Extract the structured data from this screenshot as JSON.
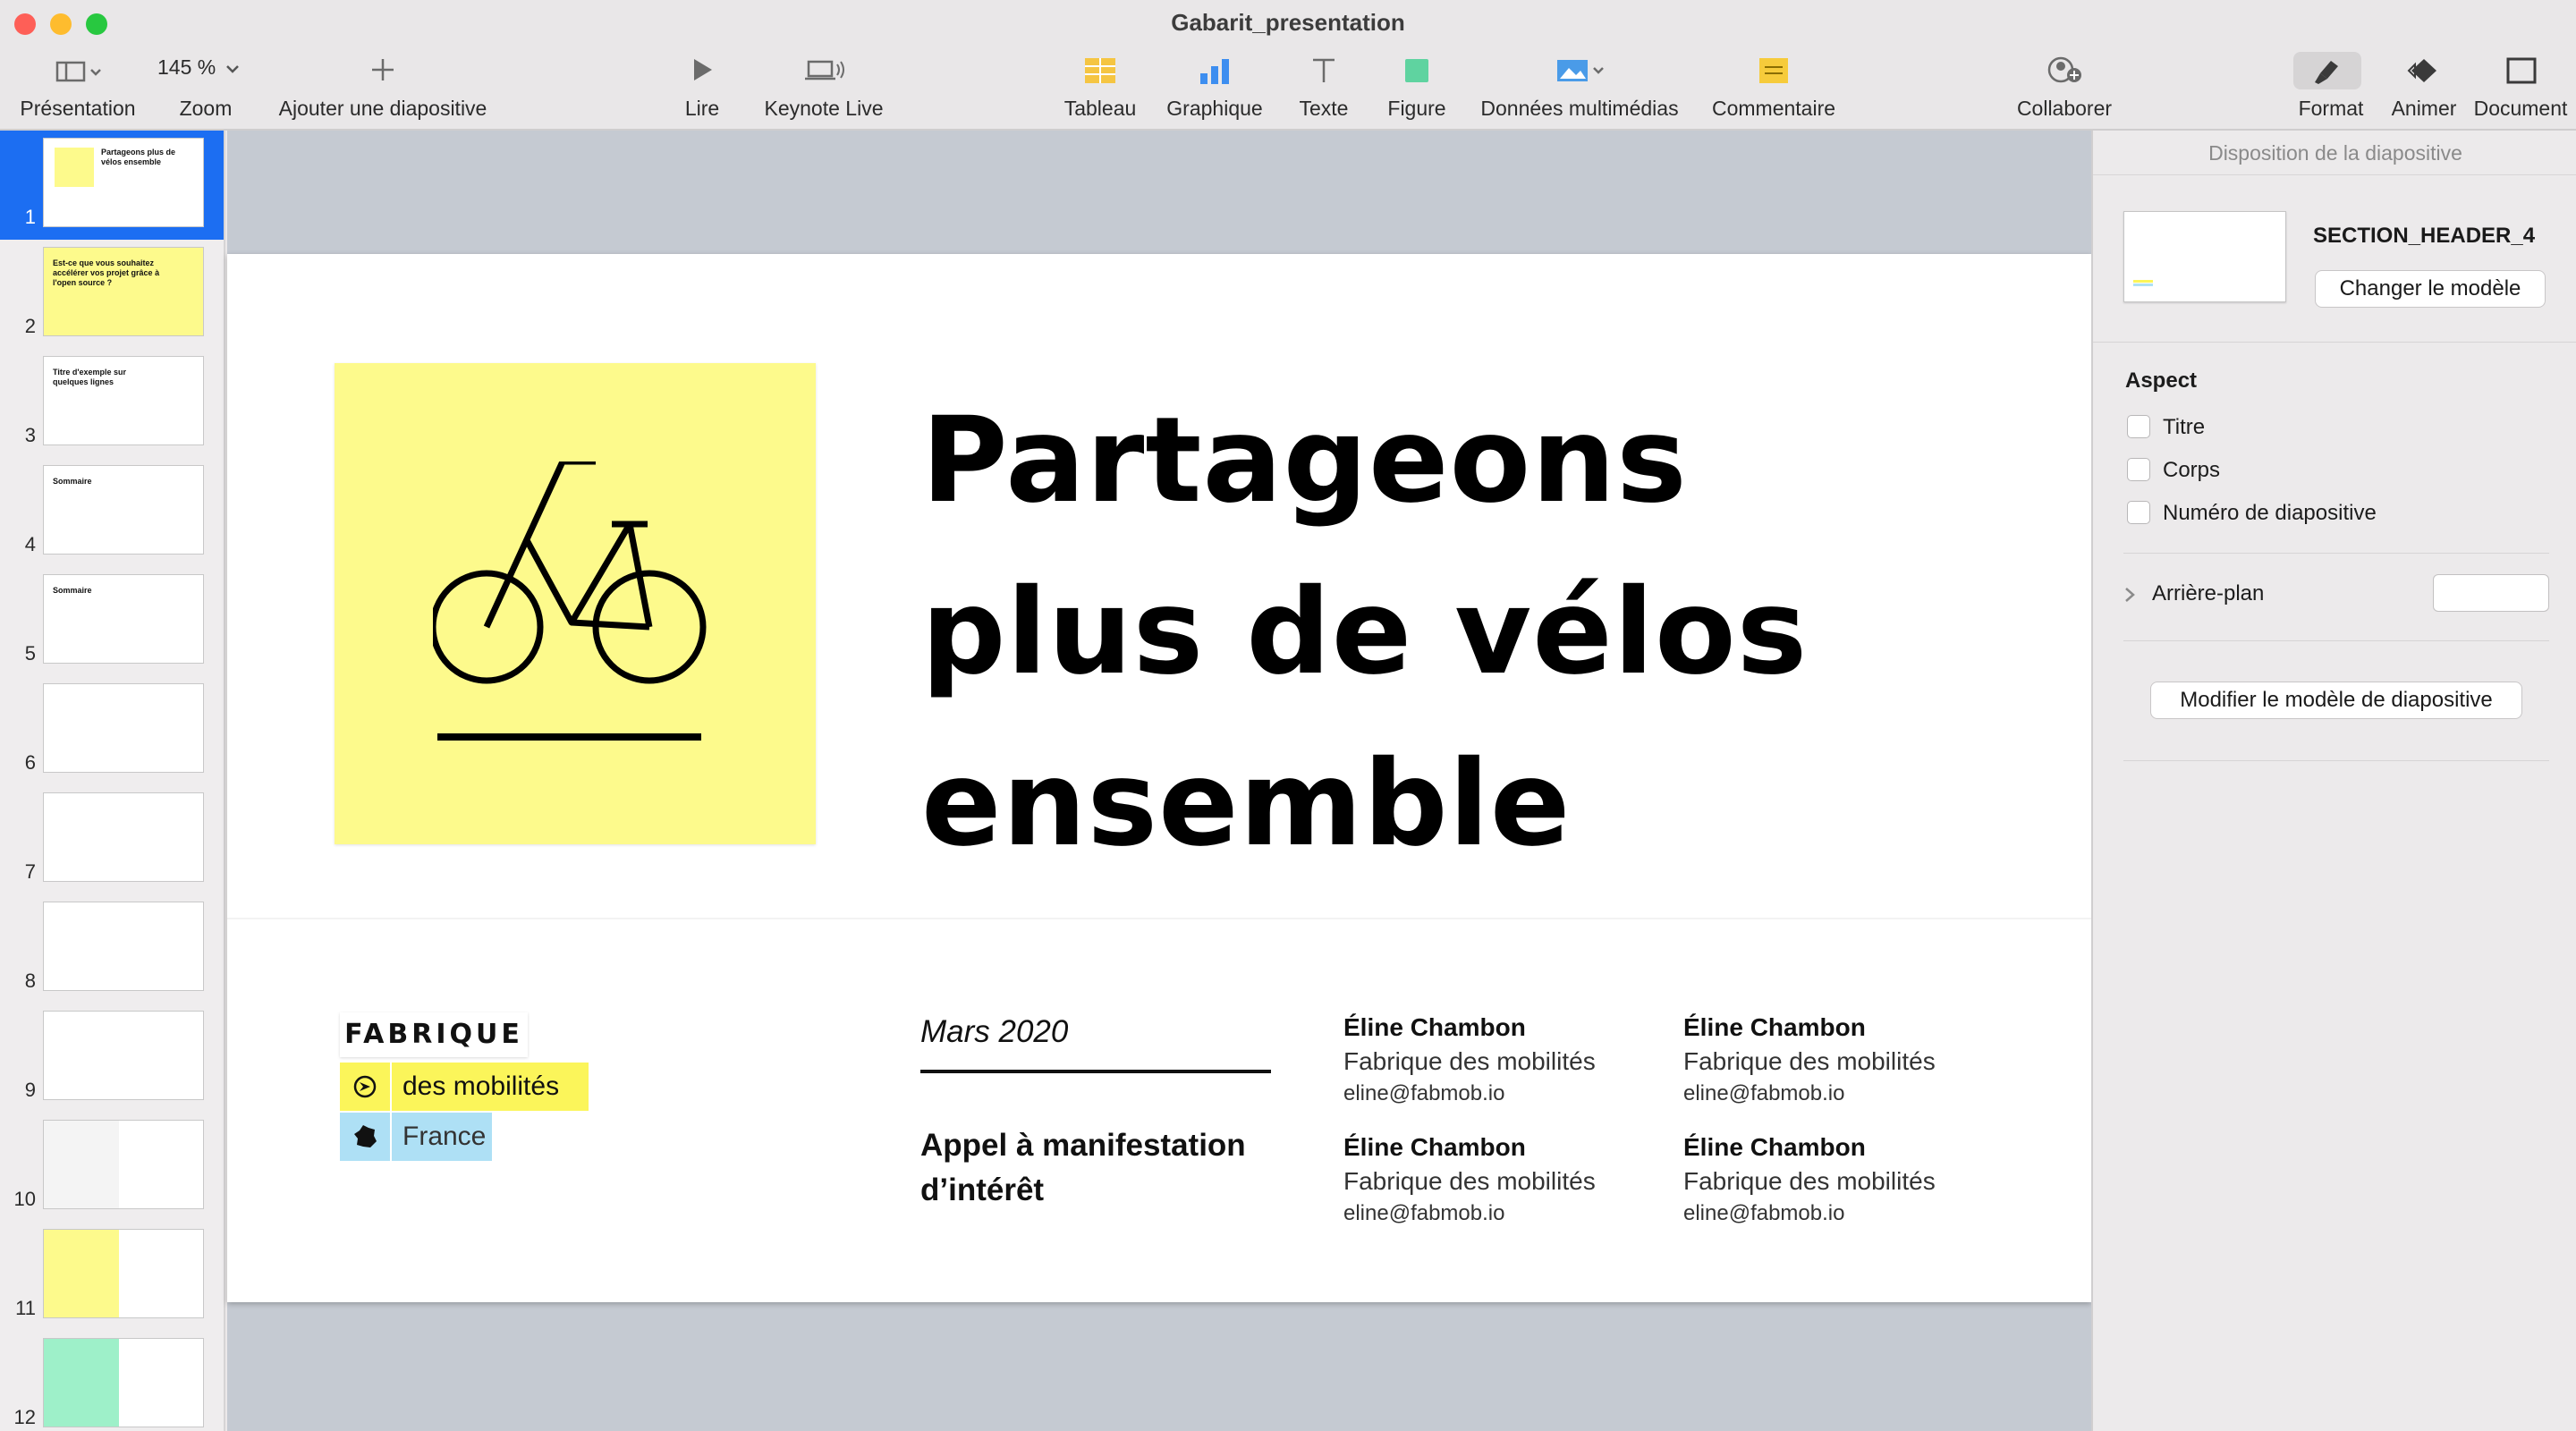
{
  "window": {
    "title": "Gabarit_presentation"
  },
  "toolbar": {
    "presentation_label": "Présentation",
    "zoom_value": "145 %",
    "zoom_label": "Zoom",
    "add_slide_label": "Ajouter une diapositive",
    "play_label": "Lire",
    "keynote_live_label": "Keynote Live",
    "table_label": "Tableau",
    "chart_label": "Graphique",
    "text_label": "Texte",
    "shape_label": "Figure",
    "media_label": "Données multimédias",
    "comment_label": "Commentaire",
    "collaborate_label": "Collaborer",
    "format_label": "Format",
    "animate_label": "Animer",
    "document_label": "Document"
  },
  "navigator": {
    "selected": 1,
    "slides": [
      {
        "num": "1",
        "title": "Partageons plus de vélos ensemble"
      },
      {
        "num": "2",
        "title": "Est-ce que vous souhaitez accélérer vos projet grâce à l'open source ?"
      },
      {
        "num": "3",
        "title": "Titre d'exemple sur quelques lignes"
      },
      {
        "num": "4",
        "title": "Sommaire"
      },
      {
        "num": "5",
        "title": "Sommaire"
      },
      {
        "num": "6",
        "title": ""
      },
      {
        "num": "7",
        "title": ""
      },
      {
        "num": "8",
        "title": ""
      },
      {
        "num": "9",
        "title": ""
      },
      {
        "num": "10",
        "title": ""
      },
      {
        "num": "11",
        "title": ""
      },
      {
        "num": "12",
        "title": ""
      }
    ]
  },
  "slide": {
    "title_line1": "Partageons",
    "title_line2": "plus de vélos",
    "title_line3": "ensemble",
    "date": "Mars 2020",
    "subtitle_line1": "Appel à manifestation",
    "subtitle_line2": "d’intérêt",
    "logo": {
      "word1": "FABRIQUE",
      "word2": "des mobilités",
      "word3": "France"
    },
    "contacts": [
      {
        "name": "Éline Chambon",
        "org": "Fabrique des mobilités",
        "email": "eline@fabmob.io"
      },
      {
        "name": "Éline Chambon",
        "org": "Fabrique des mobilités",
        "email": "eline@fabmob.io"
      },
      {
        "name": "Éline Chambon",
        "org": "Fabrique des mobilités",
        "email": "eline@fabmob.io"
      },
      {
        "name": "Éline Chambon",
        "org": "Fabrique des mobilités",
        "email": "eline@fabmob.io"
      }
    ],
    "colors": {
      "yellow": "#fdfa8c",
      "logo_yellow": "#fbf55a",
      "logo_blue": "#aee0f5",
      "accent": "#1c6ef2"
    }
  },
  "inspector": {
    "header": "Disposition de la diapositive",
    "layout_name": "SECTION_HEADER_4",
    "change_master_label": "Changer le modèle",
    "appearance_label": "Aspect",
    "checkboxes": [
      {
        "label": "Titre",
        "checked": false
      },
      {
        "label": "Corps",
        "checked": false
      },
      {
        "label": "Numéro de diapositive",
        "checked": false
      }
    ],
    "background_label": "Arrière-plan",
    "edit_master_label": "Modifier le modèle de diapositive"
  }
}
